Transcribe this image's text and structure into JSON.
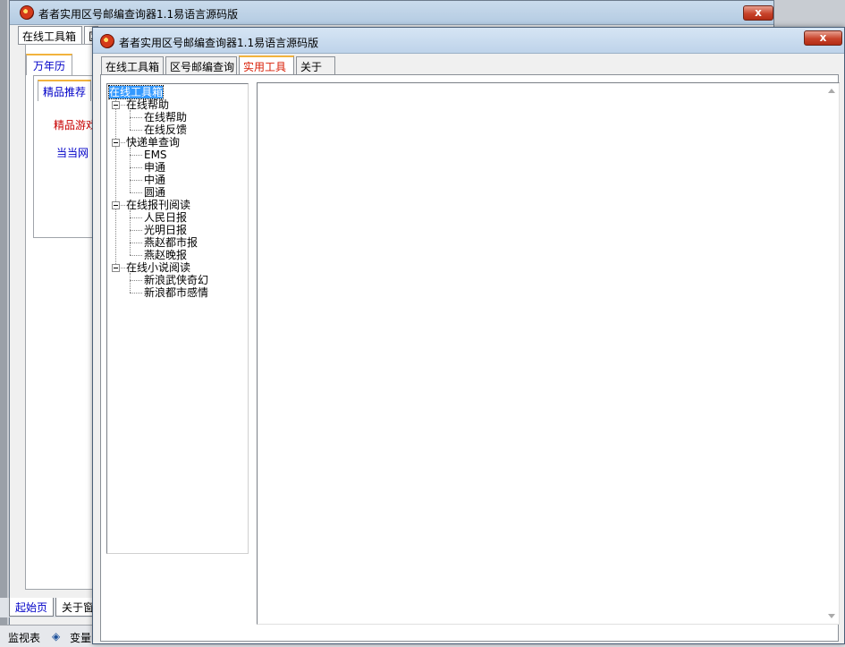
{
  "back_window": {
    "title": "者者实用区号邮编查询器1.1易语言源码版",
    "close_label": "x",
    "tabs": [
      "在线工具箱",
      "区"
    ],
    "calendar_tab": "万年历",
    "recommend_tab": "精品推荐",
    "links": [
      "精品游戏",
      "当当网"
    ]
  },
  "front_window": {
    "title": "者者实用区号邮编查询器1.1易语言源码版",
    "close_label": "x",
    "tabs": [
      "在线工具箱",
      "区号邮编查询",
      "实用工具",
      "关于"
    ],
    "active_tab": "实用工具",
    "tree": {
      "root": "在线工具箱",
      "groups": [
        {
          "label": "在线帮助",
          "children": [
            "在线帮助",
            "在线反馈"
          ]
        },
        {
          "label": "快递单查询",
          "children": [
            "EMS",
            "申通",
            "中通",
            "圆通"
          ]
        },
        {
          "label": "在线报刊阅读",
          "children": [
            "人民日报",
            "光明日报",
            "燕赵都市报",
            "燕赵晚报"
          ]
        },
        {
          "label": "在线小说阅读",
          "children": [
            "新浪武侠奇幻",
            "新浪都市感情"
          ]
        }
      ]
    }
  },
  "ide": {
    "bottom_tabs": [
      "起始页",
      "关于窗"
    ],
    "bottom_items": [
      "监视表",
      "变量"
    ]
  },
  "colors": {
    "selected_tree": "#3399ff",
    "active_tab_text": "#d81e06",
    "link_red": "#c80000",
    "link_blue": "#0000c8"
  }
}
